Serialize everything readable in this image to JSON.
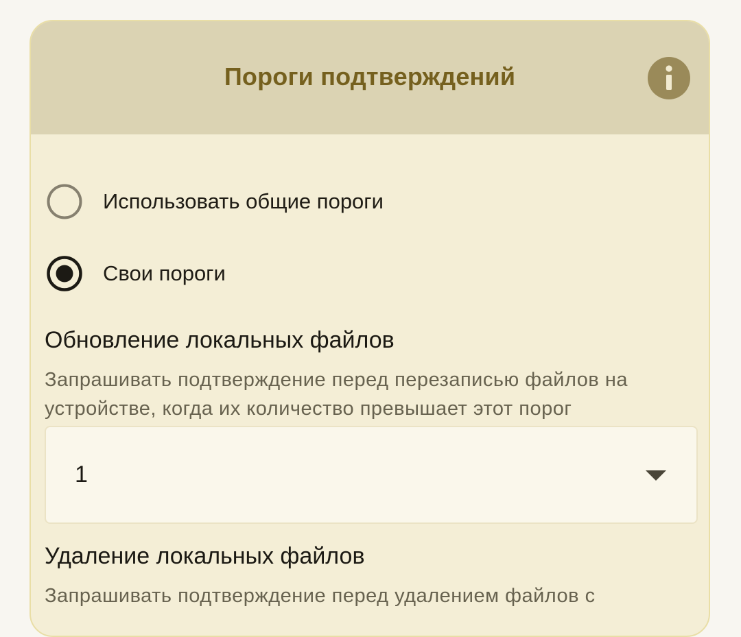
{
  "card": {
    "title": "Пороги подтверждений",
    "info_icon": "info-icon"
  },
  "mode": {
    "options": [
      {
        "label": "Использовать общие пороги",
        "selected": false
      },
      {
        "label": "Свои пороги",
        "selected": true
      }
    ]
  },
  "update_local": {
    "title": "Обновление локальных файлов",
    "description": "Запрашивать подтверждение перед перезаписью файлов на устройстве, когда их количество превышает этот порог",
    "selected_value": "1",
    "dropdown_icon": "caret-down-icon"
  },
  "delete_local": {
    "title": "Удаление локальных файлов",
    "description": "Запрашивать подтверждение перед удалением файлов с"
  },
  "colors": {
    "header_bg": "#dbd3b3",
    "title_text": "#75601e",
    "card_bg": "#f4eed6",
    "info_button": "#9a8a59"
  }
}
